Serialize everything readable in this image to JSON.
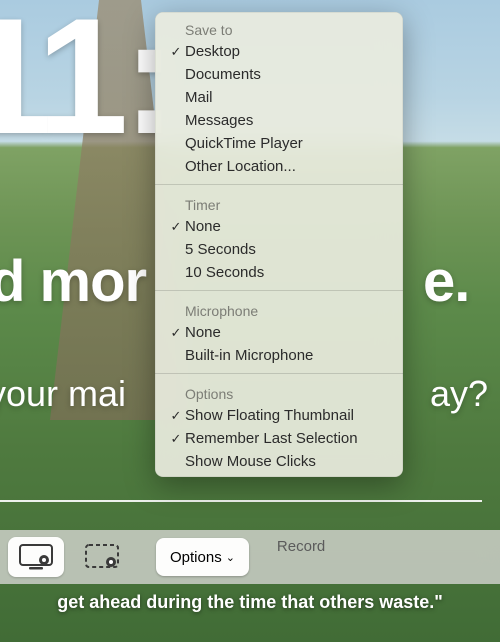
{
  "hero": {
    "numbers": "11:",
    "line1_head": "d mor",
    "line1_tail": "e.",
    "line2_head": "your mai",
    "line2_tail": "ay?"
  },
  "menu": {
    "save_to": {
      "title": "Save to",
      "items": [
        {
          "label": "Desktop",
          "checked": true
        },
        {
          "label": "Documents",
          "checked": false
        },
        {
          "label": "Mail",
          "checked": false
        },
        {
          "label": "Messages",
          "checked": false
        },
        {
          "label": "QuickTime Player",
          "checked": false
        },
        {
          "label": "Other Location...",
          "checked": false
        }
      ]
    },
    "timer": {
      "title": "Timer",
      "items": [
        {
          "label": "None",
          "checked": true
        },
        {
          "label": "5 Seconds",
          "checked": false
        },
        {
          "label": "10 Seconds",
          "checked": false
        }
      ]
    },
    "microphone": {
      "title": "Microphone",
      "items": [
        {
          "label": "None",
          "checked": true
        },
        {
          "label": "Built-in Microphone",
          "checked": false
        }
      ]
    },
    "options": {
      "title": "Options",
      "items": [
        {
          "label": "Show Floating Thumbnail",
          "checked": true
        },
        {
          "label": "Remember Last Selection",
          "checked": true
        },
        {
          "label": "Show Mouse Clicks",
          "checked": false
        }
      ]
    }
  },
  "toolbar": {
    "options_label": "Options",
    "record_label": "Record"
  },
  "quote": "get ahead during the time that others waste.\""
}
